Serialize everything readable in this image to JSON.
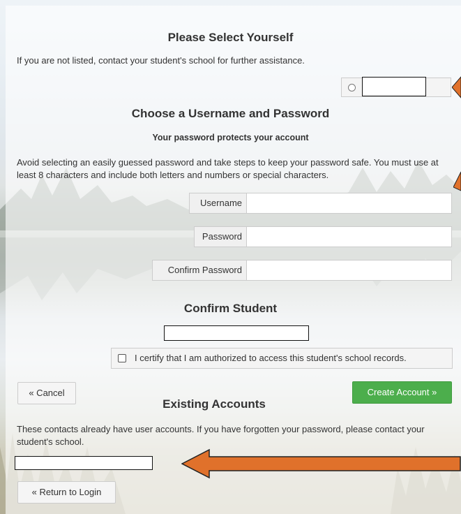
{
  "select_yourself": {
    "title": "Please Select Yourself",
    "note": "If you are not listed, contact your student's school for further assistance."
  },
  "credentials": {
    "title": "Choose a Username and Password",
    "subtitle": "Your password protects your account",
    "instructions": "Avoid selecting an easily guessed password and take steps to keep your password safe. You must use at least 8 characters and include both letters and numbers or special characters.",
    "username_label": "Username",
    "password_label": "Password",
    "confirm_password_label": "Confirm Password"
  },
  "confirm_student": {
    "title": "Confirm Student",
    "certify_label": "I certify that I am authorized to access this student's school records."
  },
  "actions": {
    "cancel_label": "« Cancel",
    "create_label": "Create Account »"
  },
  "existing_accounts": {
    "title": "Existing Accounts",
    "note": "These contacts already have user accounts. If you have forgotten your password, please contact your student's school.",
    "return_label": "« Return to Login"
  },
  "colors": {
    "arrow": "#e0712b",
    "create_button": "#4cae4c"
  }
}
